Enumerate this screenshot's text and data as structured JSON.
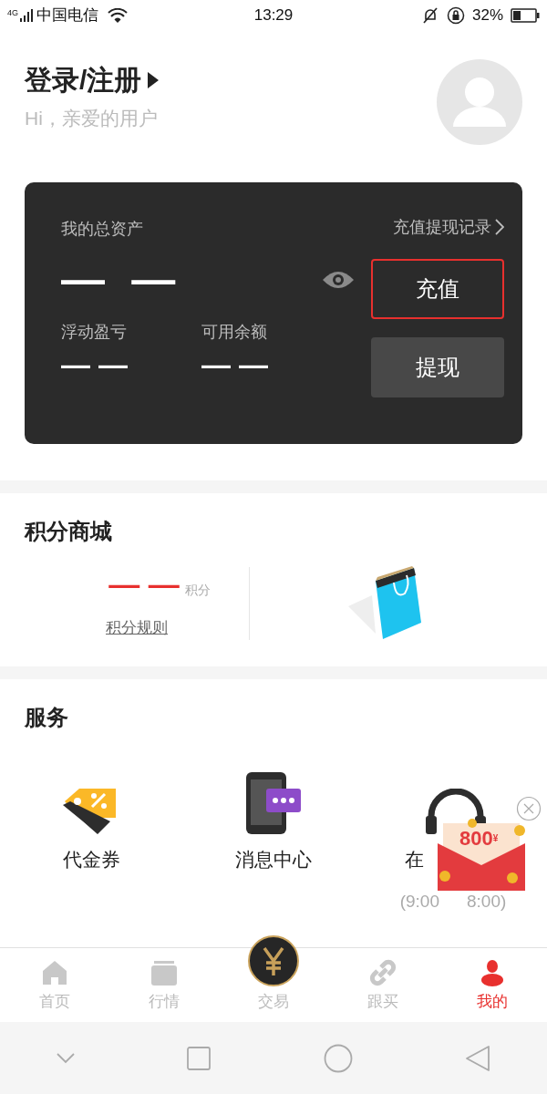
{
  "status_bar": {
    "network": "4G",
    "carrier": "中国电信",
    "time": "13:29",
    "battery": "32%"
  },
  "header": {
    "title": "登录/注册",
    "subtitle": "Hi，亲爱的用户"
  },
  "assets": {
    "label": "我的总资产",
    "total": "— —",
    "records_link": "充值提现记录",
    "float_label": "浮动盈亏",
    "float_value": "— —",
    "available_label": "可用余额",
    "available_value": "— —",
    "buttons": [
      {
        "label": "充值",
        "kind": "outline"
      },
      {
        "label": "提现",
        "kind": "filled"
      }
    ]
  },
  "points": {
    "title": "积分商城",
    "value": "— —",
    "unit": "积分",
    "rules_link": "积分规则"
  },
  "services": {
    "title": "服务",
    "items": [
      {
        "label": "代金券",
        "kind": "coupon"
      },
      {
        "label": "消息中心",
        "kind": "message"
      },
      {
        "label": "在",
        "kind": "support",
        "hours_start": "(9:00",
        "hours_end": "8:00)"
      }
    ]
  },
  "promo": {
    "amount": "800",
    "currency": "¥"
  },
  "tabs": [
    {
      "label": "首页",
      "kind": "home",
      "selected": false
    },
    {
      "label": "行情",
      "kind": "market",
      "selected": false
    },
    {
      "label": "交易",
      "kind": "trade",
      "selected": false
    },
    {
      "label": "跟买",
      "kind": "follow",
      "selected": false
    },
    {
      "label": "我的",
      "kind": "me",
      "selected": true
    }
  ]
}
